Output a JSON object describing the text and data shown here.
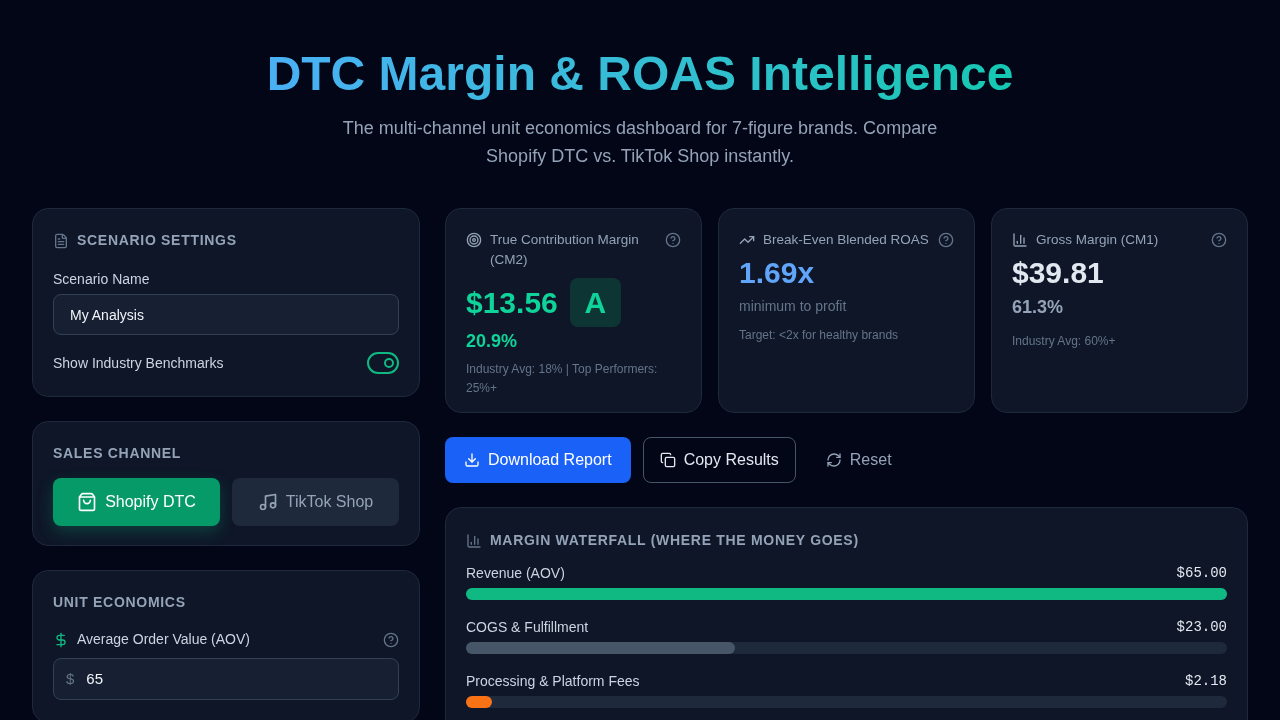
{
  "header": {
    "title": "DTC Margin & ROAS Intelligence",
    "subtitle": "The multi-channel unit economics dashboard for 7-figure brands. Compare Shopify DTC vs. TikTok Shop instantly."
  },
  "scenario_settings": {
    "title": "SCENARIO SETTINGS",
    "name_label": "Scenario Name",
    "name_value": "My Analysis",
    "benchmarks_label": "Show Industry Benchmarks",
    "benchmarks_on": true
  },
  "sales_channel": {
    "title": "SALES CHANNEL",
    "options": [
      {
        "label": "Shopify DTC",
        "kind": "shopify",
        "selected": true
      },
      {
        "label": "TikTok Shop",
        "kind": "tiktok",
        "selected": false
      }
    ]
  },
  "unit_economics": {
    "title": "UNIT ECONOMICS",
    "fields": [
      {
        "label": "Average Order Value (AOV)",
        "prefix": "$",
        "value": "65"
      }
    ]
  },
  "metrics": [
    {
      "kind": "contribution",
      "title": "True Contribution Margin (CM2)",
      "value": "$13.56",
      "color": "#10d39a",
      "grade": "A",
      "sub": "20.9%",
      "note": "Industry Avg: 18% | Top Performers: 25%+"
    },
    {
      "kind": "roas",
      "title": "Break-Even Blended ROAS",
      "value": "1.69x",
      "color": "#60a5fa",
      "sub": "minimum to profit",
      "note": "Target: <2x for healthy brands"
    },
    {
      "kind": "gross",
      "title": "Gross Margin (CM1)",
      "value": "$39.81",
      "color": "#e2e8f0",
      "sub": "61.3%",
      "note": "Industry Avg: 60%+"
    }
  ],
  "actions": [
    {
      "kind": "download",
      "label": "Download Report"
    },
    {
      "kind": "copy",
      "label": "Copy Results"
    },
    {
      "kind": "reset",
      "label": "Reset"
    }
  ],
  "waterfall": {
    "title": "MARGIN WATERFALL (WHERE THE MONEY GOES)",
    "rows": [
      {
        "label": "Revenue (AOV)",
        "amount": "$65.00",
        "level": 1,
        "color": "#10b981"
      },
      {
        "label": "COGS & Fulfillment",
        "amount": "$23.00",
        "level": 0.354,
        "color": "#475569"
      },
      {
        "label": "Processing & Platform Fees",
        "amount": "$2.18",
        "level": 0.034,
        "color": "#f97316"
      }
    ]
  }
}
